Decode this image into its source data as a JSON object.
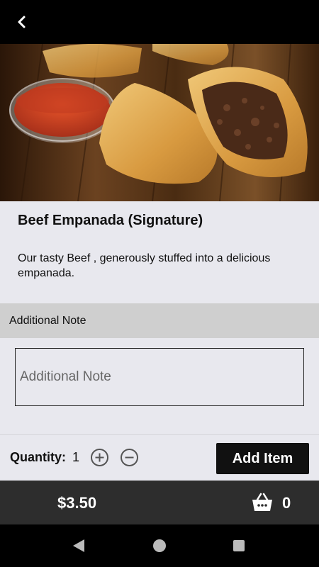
{
  "header": {
    "back_icon": "chevron-left-icon"
  },
  "hero": {
    "image_subject": "empanadas-with-sauce"
  },
  "product": {
    "title": "Beef Empanada (Signature)",
    "description": "Our tasty Beef , generously stuffed into a delicious empanada."
  },
  "note": {
    "section_label": "Additional Note",
    "placeholder": "Additional Note",
    "value": ""
  },
  "quantity": {
    "label": "Quantity:",
    "value": "1",
    "increase_icon": "plus-circle-icon",
    "decrease_icon": "minus-circle-icon",
    "add_button_label": "Add Item"
  },
  "footer": {
    "price": "$3.50",
    "cart_icon": "basket-icon",
    "cart_count": "0"
  },
  "system_nav": {
    "back_icon": "triangle-back-icon",
    "home_icon": "circle-home-icon",
    "recent_icon": "square-recent-icon"
  },
  "colors": {
    "top_bar": "#000000",
    "footer_bar": "#2d2d2d",
    "add_button": "#111111",
    "page_bg": "#e8e8ee",
    "note_header_bg": "#cfcfcf"
  }
}
